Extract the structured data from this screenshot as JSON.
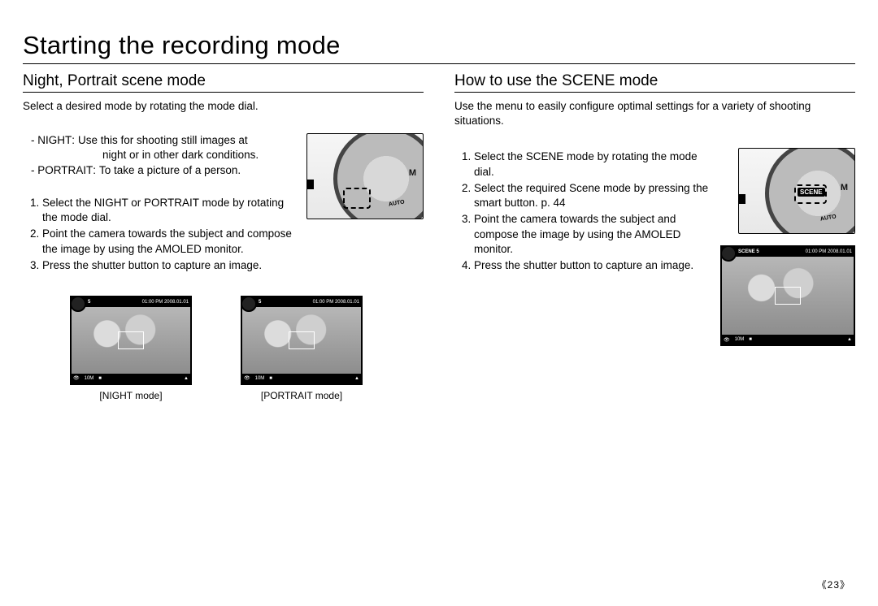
{
  "page_title": "Starting the recording mode",
  "page_number": "《23》",
  "left": {
    "heading": "Night, Portrait scene mode",
    "intro": "Select a desired mode by rotating the mode dial.",
    "defs": [
      {
        "label": "- NIGHT",
        "sep": " : ",
        "desc1": "Use this for shooting still images at",
        "desc2": "night or in other dark conditions."
      },
      {
        "label": "- PORTRAIT",
        "sep": " : ",
        "desc1": "To take a picture of a person.",
        "desc2": ""
      }
    ],
    "steps": [
      "Select the NIGHT or PORTRAIT mode by rotating the mode dial.",
      "Point the camera towards the subject and compose the image by using the AMOLED monitor.",
      "Press the shutter button to capture an image."
    ],
    "thumb_timestamp": "01:00 PM 2008.01.01",
    "thumb_count": "5",
    "thumb_bottom": "10M",
    "captions": [
      "[NIGHT mode]",
      "[PORTRAIT mode]"
    ]
  },
  "right": {
    "heading": "How to use the SCENE mode",
    "intro": "Use the menu to easily configure optimal settings for a variety of shooting situations.",
    "steps": [
      "Select the SCENE mode by rotating the mode dial.",
      "Select the required Scene mode by pressing the smart button. p. 44",
      "Point the camera towards the subject and compose the image by using the AMOLED monitor.",
      "Press the shutter button to capture an image."
    ],
    "scene_label": "SCENE",
    "dial_m": "M",
    "dial_auto": "AUTO",
    "thumb_timestamp": "01:00 PM 2008.01.01",
    "thumb_count": "5",
    "thumb_mode": "SCENE",
    "thumb_bottom": "10M"
  }
}
